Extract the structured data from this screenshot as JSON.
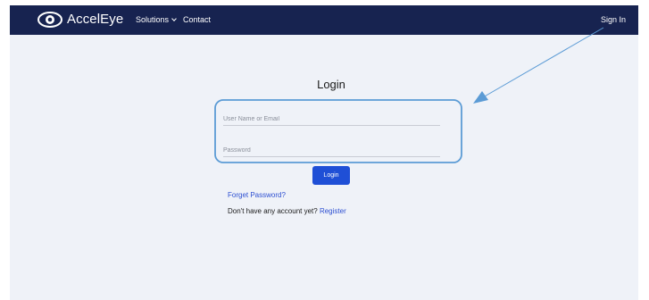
{
  "navbar": {
    "brand": "AccelEye",
    "brand_icon": "eye-icon",
    "solutions_label": "Solutions",
    "contact_label": "Contact",
    "signin_label": "Sign In"
  },
  "login": {
    "title": "Login",
    "username_placeholder": "User Name or Email",
    "username_value": "",
    "password_placeholder": "Password",
    "password_value": "",
    "button_label": "Login",
    "forgot_label": "Forget Password?",
    "no_account_text": "Don't have any account yet?",
    "register_label": "Register"
  },
  "colors": {
    "navbar_bg": "#172350",
    "page_bg": "#eff2f8",
    "button_bg": "#1f4fd6",
    "link": "#2d4fd1",
    "annotation": "#5b9bd5"
  },
  "annotation": {
    "type": "arrow",
    "from": "sign-in-link",
    "to": "login-form"
  }
}
